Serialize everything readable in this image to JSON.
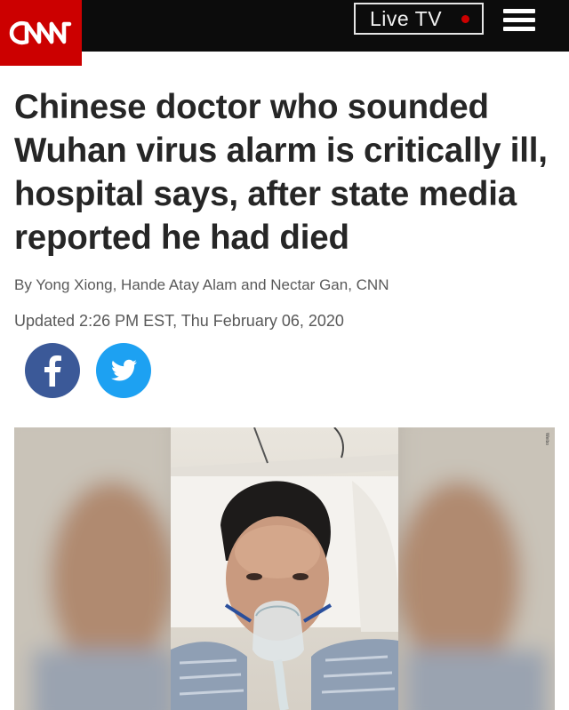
{
  "header": {
    "logo_text": "CNN",
    "live_label": "Live TV",
    "brand_color": "#cc0000",
    "bar_color": "#0c0c0c",
    "menu_icon": "hamburger-menu-icon"
  },
  "article": {
    "headline": "Chinese doctor who sounded Wuhan virus alarm is critically ill, hospital says, after state media reported he had died",
    "byline": "By Yong Xiong, Hande Atay Alam and Nectar Gan, CNN",
    "updated": "Updated 2:26 PM EST, Thu February 06, 2020"
  },
  "share": {
    "facebook_icon": "facebook-icon",
    "facebook_color": "#3b5998",
    "twitter_icon": "twitter-icon",
    "twitter_color": "#1da1f2"
  },
  "photo": {
    "credit": "Weibo"
  }
}
